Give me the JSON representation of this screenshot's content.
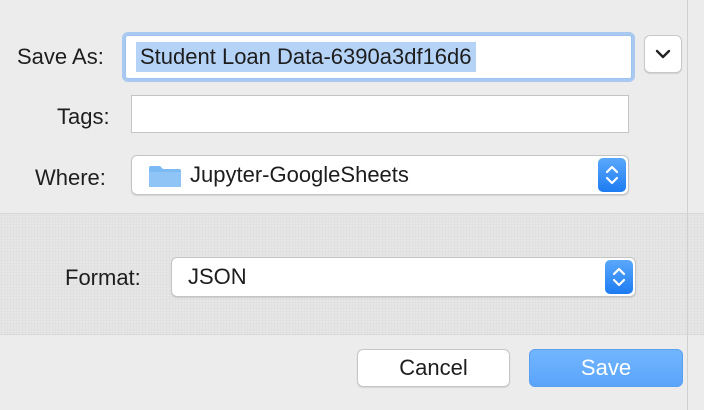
{
  "dialog": {
    "save_as": {
      "label": "Save As:",
      "value": "Student Loan Data-6390a3df16d6"
    },
    "tags": {
      "label": "Tags:",
      "value": ""
    },
    "where": {
      "label": "Where:",
      "value": "Jupyter-GoogleSheets",
      "icon": "folder-icon"
    },
    "format": {
      "label": "Format:",
      "value": "JSON"
    },
    "buttons": {
      "cancel": "Cancel",
      "save": "Save"
    },
    "icons": {
      "expand": "chevron-down-icon",
      "stepper": "up-down-stepper-icon"
    },
    "colors": {
      "accent": "#1d7cf2",
      "selection": "#b5d3f7",
      "focus_ring": "#a9c9f1",
      "save_button": "#64aaff",
      "folder": "#7db9f3"
    }
  }
}
